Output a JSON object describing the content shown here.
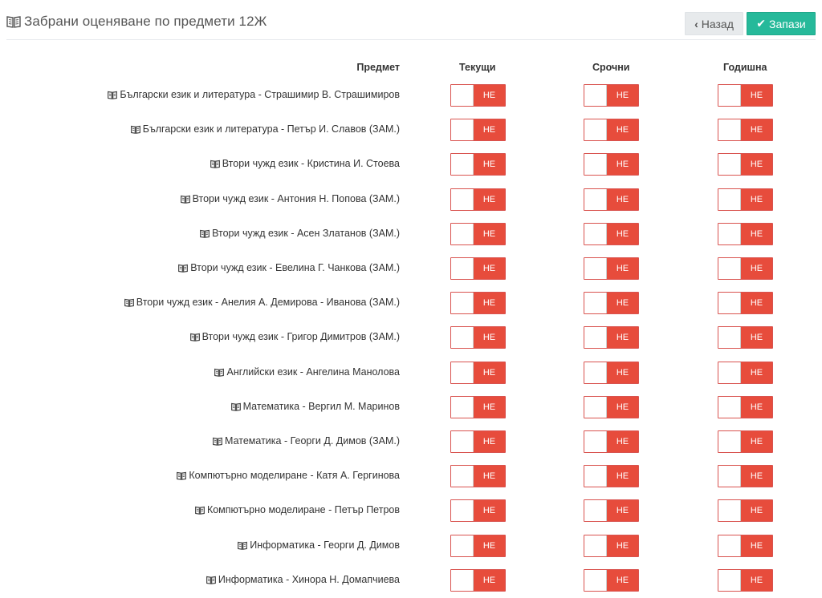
{
  "header": {
    "title": "Забрани оценяване по предмети 12Ж"
  },
  "buttons": {
    "back": "Назад",
    "save": "Запази"
  },
  "columns": {
    "subject": "Предмет",
    "current": "Текущи",
    "term": "Срочни",
    "annual": "Годишна"
  },
  "rows": [
    {
      "subject": "Български език и литература - Страшимир В. Страшимиров",
      "current": "НЕ",
      "term": "НЕ",
      "annual": "НЕ"
    },
    {
      "subject": "Български език и литература - Петър И. Славов (ЗАМ.)",
      "current": "НЕ",
      "term": "НЕ",
      "annual": "НЕ"
    },
    {
      "subject": "Втори чужд език - Кристина И. Стоева",
      "current": "НЕ",
      "term": "НЕ",
      "annual": "НЕ"
    },
    {
      "subject": "Втори чужд език - Антония Н. Попова (ЗАМ.)",
      "current": "НЕ",
      "term": "НЕ",
      "annual": "НЕ"
    },
    {
      "subject": "Втори чужд език - Асен Златанов (ЗАМ.)",
      "current": "НЕ",
      "term": "НЕ",
      "annual": "НЕ"
    },
    {
      "subject": "Втори чужд език - Евелина Г. Чанкова (ЗАМ.)",
      "current": "НЕ",
      "term": "НЕ",
      "annual": "НЕ"
    },
    {
      "subject": "Втори чужд език - Анелия А. Демирова - Иванова (ЗАМ.)",
      "current": "НЕ",
      "term": "НЕ",
      "annual": "НЕ"
    },
    {
      "subject": "Втори чужд език - Григор Димитров (ЗАМ.)",
      "current": "НЕ",
      "term": "НЕ",
      "annual": "НЕ"
    },
    {
      "subject": "Английски език - Ангелина Манолова",
      "current": "НЕ",
      "term": "НЕ",
      "annual": "НЕ"
    },
    {
      "subject": "Математика - Вергил М. Маринов",
      "current": "НЕ",
      "term": "НЕ",
      "annual": "НЕ"
    },
    {
      "subject": "Математика - Георги Д. Димов (ЗАМ.)",
      "current": "НЕ",
      "term": "НЕ",
      "annual": "НЕ"
    },
    {
      "subject": "Компютърно моделиране - Катя А. Гергинова",
      "current": "НЕ",
      "term": "НЕ",
      "annual": "НЕ"
    },
    {
      "subject": "Компютърно моделиране - Петър Петров",
      "current": "НЕ",
      "term": "НЕ",
      "annual": "НЕ"
    },
    {
      "subject": "Информатика - Георги Д. Димов",
      "current": "НЕ",
      "term": "НЕ",
      "annual": "НЕ"
    },
    {
      "subject": "Информатика - Хинора Н. Домапчиева",
      "current": "НЕ",
      "term": "НЕ",
      "annual": "НЕ"
    }
  ],
  "icons": {
    "title": "book-icon",
    "subject": "book-icon",
    "back": "chevron-left-icon",
    "save": "check-icon"
  },
  "colors": {
    "toggle_off": "#e74c3c",
    "save_button": "#26b99a",
    "back_button": "#e7eaec"
  }
}
